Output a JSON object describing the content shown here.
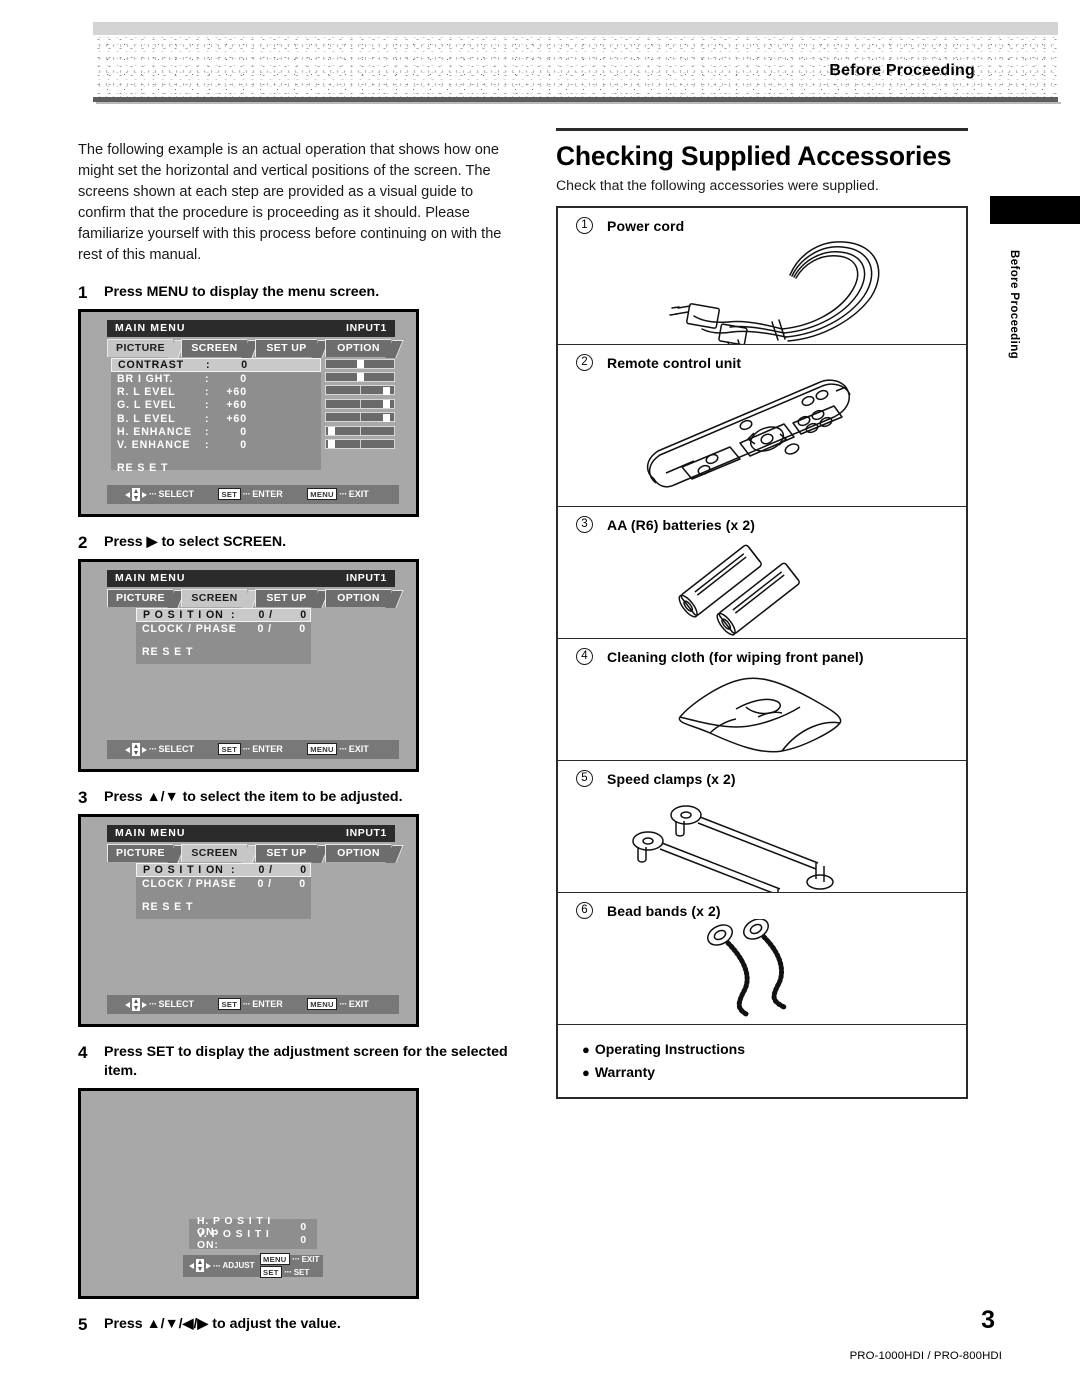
{
  "header": {
    "title": "Before Proceeding"
  },
  "sidetab": {
    "label": "Before Proceeding"
  },
  "footer": {
    "page_number": "3",
    "model": "PRO-1000HDI / PRO-800HDI"
  },
  "left": {
    "intro": "The following example is an actual operation that shows how one might set the horizontal and vertical positions of the screen. The screens shown at each step are provided as a visual guide to confirm that the procedure is proceeding as it should.  Please familiarize yourself with this process before continuing on with the rest of this manual.",
    "steps": [
      {
        "num": "1",
        "text": "Press MENU to display the menu screen."
      },
      {
        "num": "2",
        "text": "Press ▶ to select SCREEN."
      },
      {
        "num": "3",
        "text": "Press ▲/▼ to select the item to be adjusted."
      },
      {
        "num": "4",
        "text": "Press SET to display the adjustment screen for the selected item."
      },
      {
        "num": "5",
        "text": "Press ▲/▼/◀/▶ to adjust the value."
      }
    ]
  },
  "osd": {
    "title": "MAIN  MENU",
    "input": "INPUT1",
    "tabs": [
      "PICTURE",
      "SCREEN",
      "SET UP",
      "OPTION"
    ],
    "footer": {
      "select": "SELECT",
      "enter": "ENTER",
      "exit": "EXIT",
      "set_key": "SET",
      "menu_key": "MENU",
      "adjust": "ADJUST",
      "set_label": "SET",
      "dots": "···"
    },
    "screen1": {
      "rows": [
        {
          "label": "CONTRAST",
          "colon": ":",
          "value": "0",
          "selected": true,
          "knob_pct": 50
        },
        {
          "label": "BR I GHT.",
          "colon": ":",
          "value": "0",
          "selected": false,
          "knob_pct": 50
        },
        {
          "label": "R. L EVEL",
          "colon": ":",
          "value": "+60",
          "selected": false,
          "knob_pct": 88
        },
        {
          "label": "G. L EVEL",
          "colon": ":",
          "value": "+60",
          "selected": false,
          "knob_pct": 88
        },
        {
          "label": "B. L EVEL",
          "colon": ":",
          "value": "+60",
          "selected": false,
          "knob_pct": 88
        },
        {
          "label": "H. ENHANCE",
          "colon": ":",
          "value": "0",
          "selected": false,
          "knob_pct": 3
        },
        {
          "label": "V. ENHANCE",
          "colon": ":",
          "value": "0",
          "selected": false,
          "knob_pct": 3
        }
      ],
      "reset": "RE S E T",
      "active_tab": 0
    },
    "screen2": {
      "rows": [
        {
          "label": "P O S I T I ON",
          "colon": ":",
          "value": "0 /",
          "value2": "0",
          "selected": true
        },
        {
          "label": "CLOCK / PHASE",
          "colon": ":",
          "value": "0 /",
          "value2": "0",
          "selected": false
        }
      ],
      "reset": "RE S E T",
      "active_tab": 1
    },
    "screen3": {
      "rows": [
        {
          "label": "P O S I T I ON",
          "colon": ":",
          "value": "0 /",
          "value2": "0",
          "selected": true
        },
        {
          "label": "CLOCK / PHASE",
          "colon": ":",
          "value": "0 /",
          "value2": "0",
          "selected": false
        }
      ],
      "reset": "RE S E T",
      "active_tab": 1
    },
    "screen4": {
      "rows": [
        {
          "label": "H. P O S I T I ON:",
          "value": "0"
        },
        {
          "label": "V. P O S I T I ON:",
          "value": "0"
        }
      ]
    }
  },
  "right": {
    "title": "Checking Supplied Accessories",
    "lead": "Check that the following accessories were supplied.",
    "items": [
      {
        "num": "1",
        "label": "Power cord",
        "art": "power-cord-illustration"
      },
      {
        "num": "2",
        "label": "Remote control unit",
        "art": "remote-control-illustration"
      },
      {
        "num": "3",
        "label": "AA (R6) batteries (x 2)",
        "art": "batteries-illustration"
      },
      {
        "num": "4",
        "label": "Cleaning cloth (for wiping front panel)",
        "art": "cleaning-cloth-illustration"
      },
      {
        "num": "5",
        "label": "Speed clamps (x 2)",
        "art": "speed-clamps-illustration"
      },
      {
        "num": "6",
        "label": "Bead bands (x 2)",
        "art": "bead-bands-illustration"
      }
    ],
    "bullets": [
      "Operating Instructions",
      "Warranty"
    ]
  }
}
